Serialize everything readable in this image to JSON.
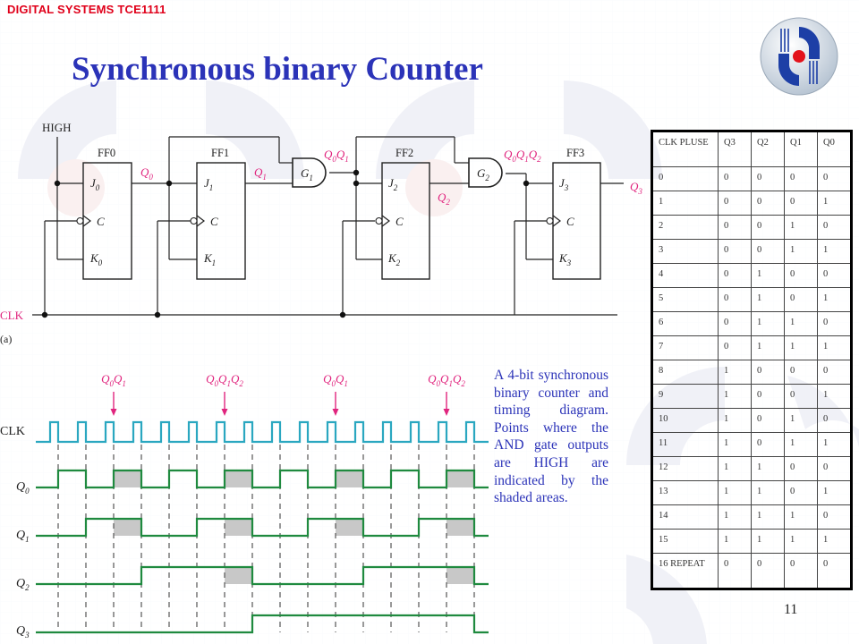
{
  "header": {
    "course": "DIGITAL SYSTEMS TCE1111",
    "title": "Synchronous binary Counter",
    "logo_icon": "university-logo-icon"
  },
  "colors": {
    "course_red": "#e0001a",
    "title_blue": "#2b33b8",
    "signal_pink": "#e0247e",
    "clk_cyan": "#2aa7c0",
    "wave_green": "#1f8a3f",
    "shade_gray": "#c8c8c8"
  },
  "circuit": {
    "high_label": "HIGH",
    "clk_label": "CLK",
    "part_label": "(a)",
    "flip_flops": [
      {
        "name": "FF0",
        "j": "J",
        "k": "K",
        "c": "C",
        "sub": "0",
        "q": "Q",
        "q_sub": "0"
      },
      {
        "name": "FF1",
        "j": "J",
        "k": "K",
        "c": "C",
        "sub": "1",
        "q": "Q",
        "q_sub": "1"
      },
      {
        "name": "FF2",
        "j": "J",
        "k": "K",
        "c": "C",
        "sub": "2",
        "q": "Q",
        "q_sub": "2"
      },
      {
        "name": "FF3",
        "j": "J",
        "k": "K",
        "c": "C",
        "sub": "3",
        "q": "Q",
        "q_sub": "3"
      }
    ],
    "gates": [
      {
        "name": "G",
        "sub": "1",
        "output_label": "Q0Q1"
      },
      {
        "name": "G",
        "sub": "2",
        "output_label": "Q0Q1Q2"
      }
    ]
  },
  "timing": {
    "clk_label": "CLK",
    "signals": [
      {
        "name": "Q",
        "sub": "0"
      },
      {
        "name": "Q",
        "sub": "1"
      },
      {
        "name": "Q",
        "sub": "2"
      },
      {
        "name": "Q",
        "sub": "3"
      }
    ],
    "markers": [
      {
        "label": "Q0Q1",
        "clock_edge": 3
      },
      {
        "label": "Q0Q1Q2",
        "clock_edge": 7
      },
      {
        "label": "Q0Q1",
        "clock_edge": 11
      },
      {
        "label": "Q0Q1Q2",
        "clock_edge": 15
      }
    ],
    "clock_pulses": 16
  },
  "caption": "A 4-bit synchronous binary counter and timing diagram. Points where the AND gate outputs are HIGH are indicated by the shaded areas.",
  "truth_table": {
    "headers": [
      "CLK PLUSE",
      "Q3",
      "Q2",
      "Q1",
      "Q0"
    ],
    "rows": [
      [
        "0",
        "0",
        "0",
        "0",
        "0"
      ],
      [
        "1",
        "0",
        "0",
        "0",
        "1"
      ],
      [
        "2",
        "0",
        "0",
        "1",
        "0"
      ],
      [
        "3",
        "0",
        "0",
        "1",
        "1"
      ],
      [
        "4",
        "0",
        "1",
        "0",
        "0"
      ],
      [
        "5",
        "0",
        "1",
        "0",
        "1"
      ],
      [
        "6",
        "0",
        "1",
        "1",
        "0"
      ],
      [
        "7",
        "0",
        "1",
        "1",
        "1"
      ],
      [
        "8",
        "1",
        "0",
        "0",
        "0"
      ],
      [
        "9",
        "1",
        "0",
        "0",
        "1"
      ],
      [
        "10",
        "1",
        "0",
        "1",
        "0"
      ],
      [
        "11",
        "1",
        "0",
        "1",
        "1"
      ],
      [
        "12",
        "1",
        "1",
        "0",
        "0"
      ],
      [
        "13",
        "1",
        "1",
        "0",
        "1"
      ],
      [
        "14",
        "1",
        "1",
        "1",
        "0"
      ],
      [
        "15",
        "1",
        "1",
        "1",
        "1"
      ],
      [
        "16 REPEAT",
        "0",
        "0",
        "0",
        "0"
      ]
    ]
  },
  "page_number": "11"
}
